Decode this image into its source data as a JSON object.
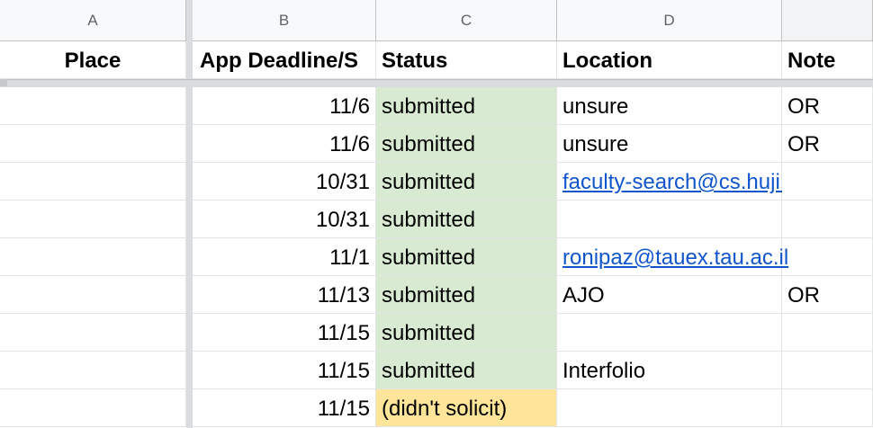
{
  "columns": [
    "A",
    "B",
    "C",
    "D",
    ""
  ],
  "headers": {
    "place": "Place",
    "deadline": "App Deadline/S",
    "status": "Status",
    "location": "Location",
    "note": "Note"
  },
  "rows": [
    {
      "deadline": "11/6",
      "status": "submitted",
      "location": "unsure",
      "note": "OR"
    },
    {
      "deadline": "11/6",
      "status": "submitted",
      "location": "unsure",
      "note": "OR"
    },
    {
      "deadline": "10/31",
      "status": "submitted",
      "location": "faculty-search@cs.huji.ac.il",
      "note": ""
    },
    {
      "deadline": "10/31",
      "status": "submitted",
      "location": "",
      "note": ""
    },
    {
      "deadline": "11/1",
      "status": "submitted",
      "location": "ronipaz@tauex.tau.ac.il",
      "note": ""
    },
    {
      "deadline": "11/13",
      "status": "submitted",
      "location": "AJO",
      "note": "OR"
    },
    {
      "deadline": "11/15",
      "status": "submitted",
      "location": "",
      "note": ""
    },
    {
      "deadline": "11/15",
      "status": "submitted",
      "location": "Interfolio",
      "note": ""
    },
    {
      "deadline": "11/15",
      "status": "(didn't solicit)",
      "location": "",
      "note": ""
    }
  ],
  "colors": {
    "submitted_fill": "#d9ead3",
    "didnt_solicit_fill": "#ffe599",
    "link": "#1155cc"
  }
}
